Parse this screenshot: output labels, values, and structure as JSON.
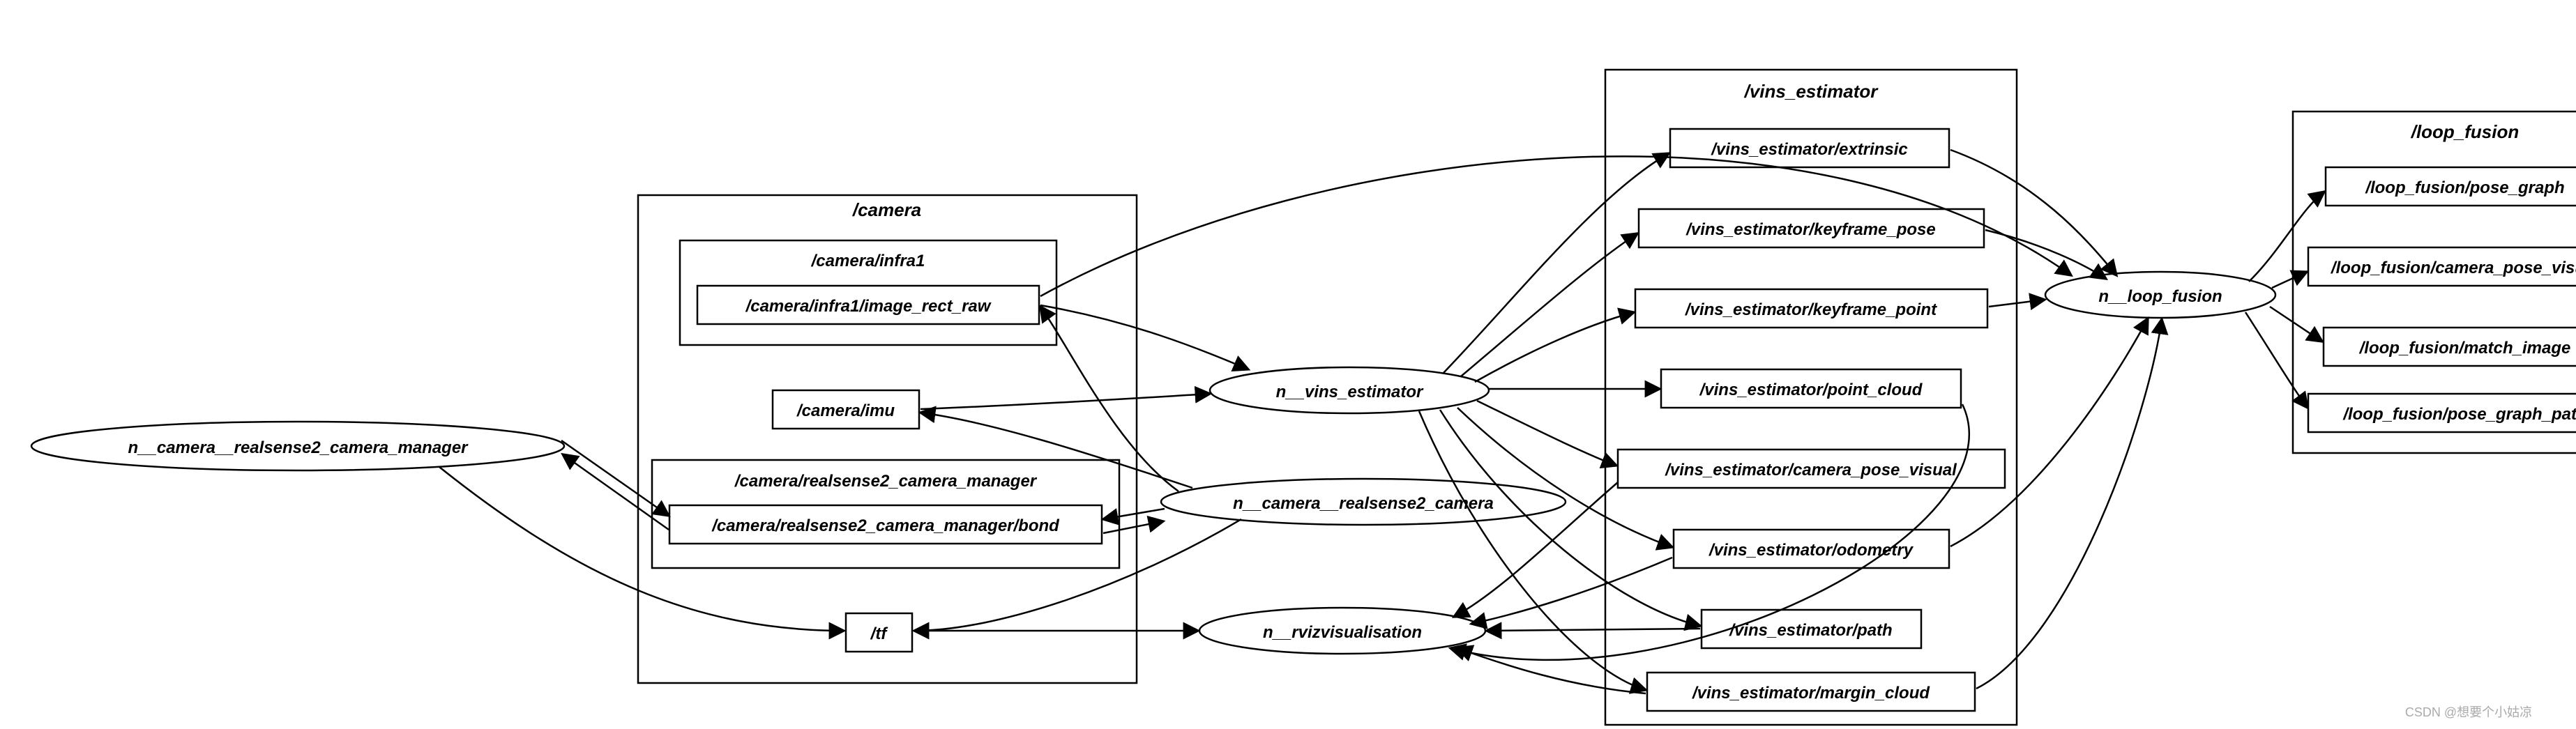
{
  "watermark": "CSDN @想要个小姑凉",
  "groups": {
    "camera": {
      "title": "/camera",
      "infra1": {
        "title": "/camera/infra1",
        "image_rect_raw": "/camera/infra1/image_rect_raw"
      },
      "imu": "/camera/imu",
      "rs_mgr": {
        "title": "/camera/realsense2_camera_manager",
        "bond": "/camera/realsense2_camera_manager/bond"
      },
      "tf": "/tf"
    },
    "vins": {
      "title": "/vins_estimator",
      "extrinsic": "/vins_estimator/extrinsic",
      "keyframe_pose": "/vins_estimator/keyframe_pose",
      "keyframe_point": "/vins_estimator/keyframe_point",
      "point_cloud": "/vins_estimator/point_cloud",
      "camera_pose_visual": "/vins_estimator/camera_pose_visual",
      "odometry": "/vins_estimator/odometry",
      "path": "/vins_estimator/path",
      "margin_cloud": "/vins_estimator/margin_cloud"
    },
    "loop": {
      "title": "/loop_fusion",
      "pose_graph": "/loop_fusion/pose_graph",
      "camera_pose_visual": "/loop_fusion/camera_pose_visual",
      "match_image": "/loop_fusion/match_image",
      "pose_graph_path": "/loop_fusion/pose_graph_path"
    }
  },
  "nodes": {
    "cam_mgr": "n__camera__realsense2_camera_manager",
    "vins_est": "n__vins_estimator",
    "rs_cam": "n__camera__realsense2_camera",
    "rviz": "n__rvizvisualisation",
    "loop": "n__loop_fusion"
  }
}
